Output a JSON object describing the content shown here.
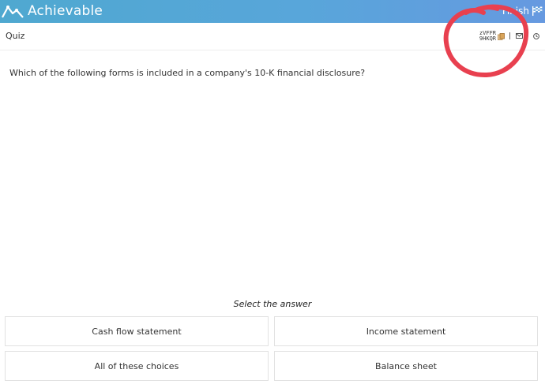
{
  "header": {
    "brand": "Achievable",
    "finish_label": "Finish",
    "logo_icon": "mountain-line-logo-icon",
    "finish_icon": "checkered-flag-icon",
    "gradient_start": "#4fa8d0",
    "gradient_end": "#6699e0"
  },
  "subheader": {
    "title": "Quiz",
    "code_line1": "zVFFR",
    "code_line2": "9HKQR",
    "icons": [
      "copy-icon",
      "mail-icon",
      "clock-icon"
    ]
  },
  "annotation": {
    "color": "#e8404f",
    "shape": "hand-drawn-circle"
  },
  "question": {
    "text": "Which of the following forms is included in a company's 10-K financial disclosure?"
  },
  "answers": {
    "prompt": "Select the answer",
    "choices": [
      {
        "label": "Cash flow statement"
      },
      {
        "label": "Income statement"
      },
      {
        "label": "All of these choices"
      },
      {
        "label": "Balance sheet"
      }
    ]
  }
}
